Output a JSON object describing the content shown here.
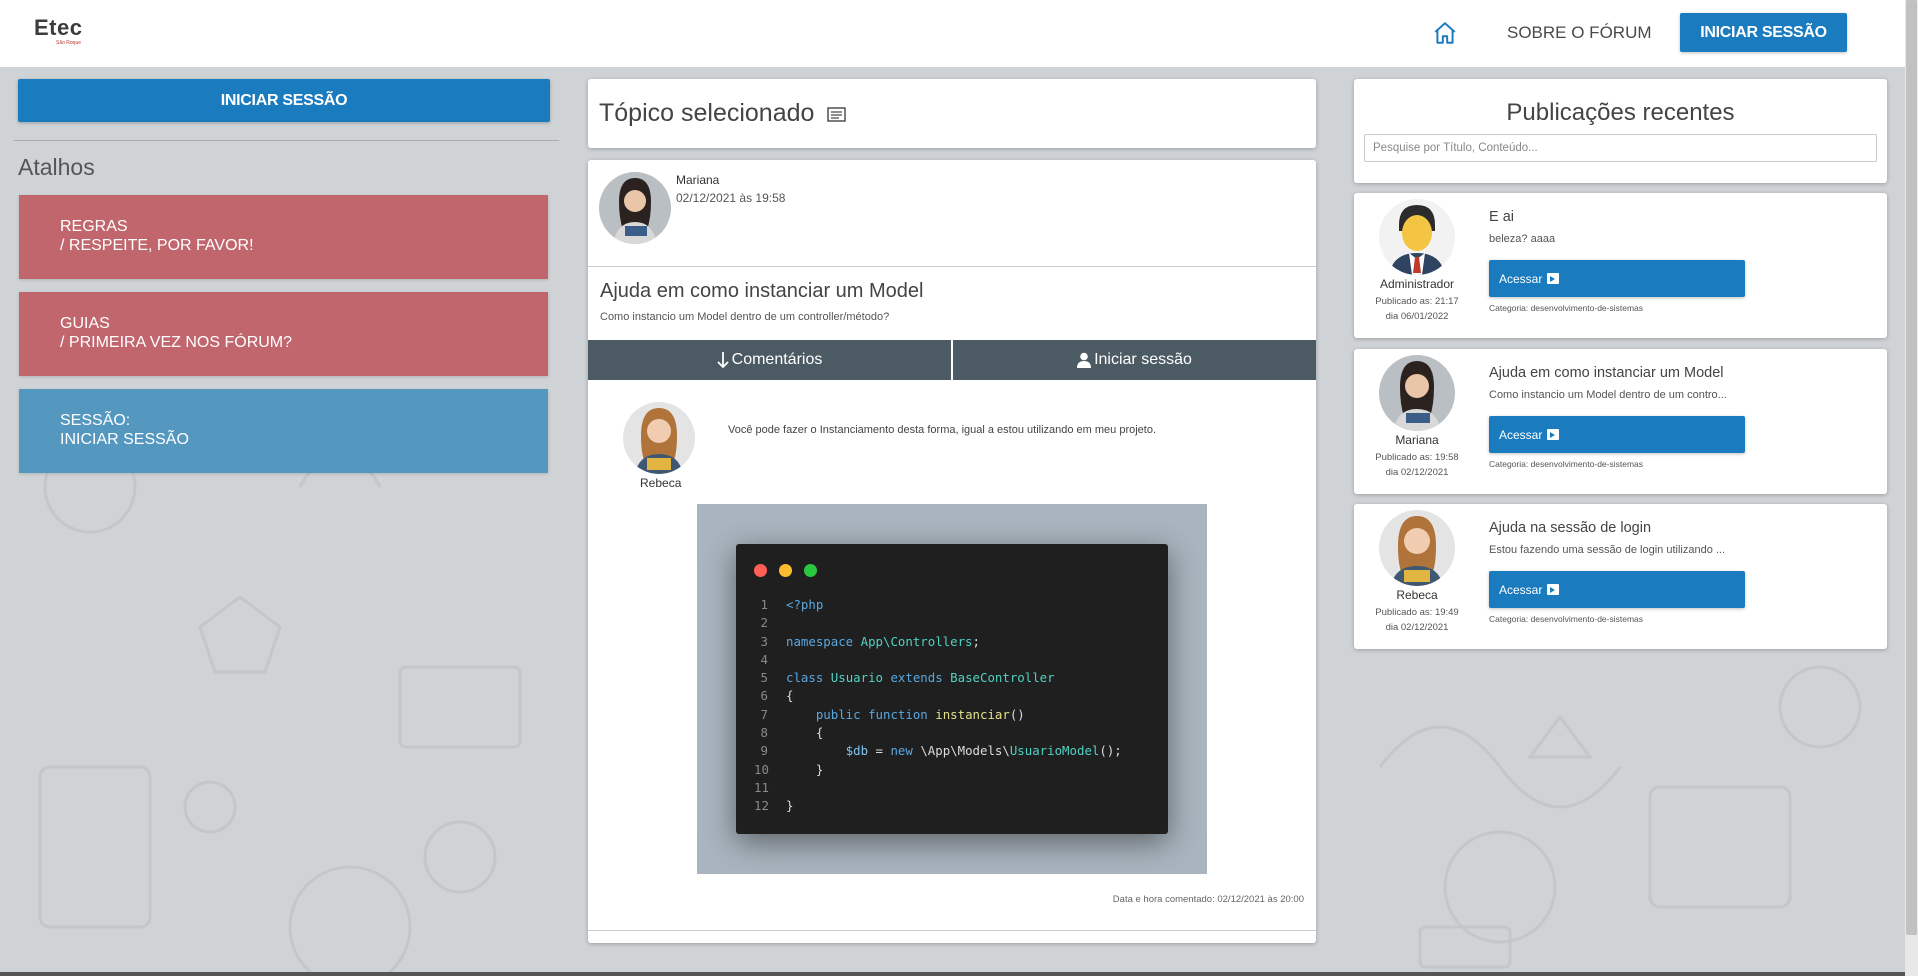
{
  "header": {
    "logo_main": "Etec",
    "logo_sub": "São Roque",
    "about_label": "SOBRE O FÓRUM",
    "login_label": "INICIAR SESSÃO"
  },
  "left": {
    "login_label": "INICIAR SESSÃO",
    "shortcuts_title": "Atalhos",
    "shortcuts": [
      {
        "line1": "REGRAS",
        "line2": "/ RESPEITE, POR FAVOR!"
      },
      {
        "line1": "GUIAS",
        "line2": "/ PRIMEIRA VEZ NOS FÓRUM?"
      },
      {
        "line1": "SESSÃO:",
        "line2": "INICIAR SESSÃO"
      }
    ]
  },
  "topic": {
    "header_title": "Tópico selecionado",
    "author": "Mariana",
    "date": "02/12/2021 às 19:58",
    "title": "Ajuda em como instanciar um Model",
    "description": "Como instancio um Model dentro de um controller/método?",
    "tab_comments": "Comentários",
    "tab_login": "Iniciar sessão",
    "comment": {
      "author": "Rebeca",
      "text": "Você pode fazer o Instanciamento desta forma, igual a estou utilizando em meu projeto.",
      "date": "Data e hora comentado: 02/12/2021 às 20:00"
    },
    "code": {
      "line_numbers": [
        "1",
        "2",
        "3",
        "4",
        "5",
        "6",
        "7",
        "8",
        "9",
        "10",
        "11",
        "12"
      ],
      "tokens": {
        "php_open": "<?php",
        "namespace_kw": "namespace",
        "namespace_name": "App\\Controllers",
        "semicolon": ";",
        "class_kw": "class",
        "class_name": "Usuario",
        "extends_kw": "extends",
        "base_class": "BaseController",
        "brace_open": "{",
        "brace_close": "}",
        "public_kw": "public",
        "function_kw": "function",
        "method_name": "instanciar",
        "parens": "()",
        "var_db": "$db",
        "equals": " = ",
        "new_kw": "new",
        "ns_path": " \\App\\Models\\",
        "model_name": "UsuarioModel",
        "call_end": "();"
      }
    }
  },
  "recent": {
    "title": "Publicações recentes",
    "search_placeholder": "Pesquise por Título, Conteúdo...",
    "posts": [
      {
        "author": "Administrador",
        "published": "Publicado as: 21:17",
        "day": "dia 06/01/2022",
        "title": "E ai",
        "desc": "beleza? aaaa",
        "button": "Acessar",
        "category": "Categoria: desenvolvimento-de-sistemas"
      },
      {
        "author": "Mariana",
        "published": "Publicado as: 19:58",
        "day": "dia 02/12/2021",
        "title": "Ajuda em como instanciar um Model",
        "desc": "Como instancio um Model dentro de um contro...",
        "button": "Acessar",
        "category": "Categoria: desenvolvimento-de-sistemas"
      },
      {
        "author": "Rebeca",
        "published": "Publicado as: 19:49",
        "day": "dia 02/12/2021",
        "title": "Ajuda na sessão de login",
        "desc": "Estou fazendo uma sessão de login utilizando ...",
        "button": "Acessar",
        "category": "Categoria: desenvolvimento-de-sistemas"
      }
    ]
  },
  "colors": {
    "primary": "#1a7bbf",
    "shortcut_red": "#c1666d",
    "shortcut_blue": "#5498c0",
    "tab_bg": "#4b5a63",
    "page_bg": "#cfd3d6"
  },
  "icons": [
    "home-icon",
    "list-icon",
    "arrow-down-icon",
    "user-icon",
    "enter-icon"
  ]
}
